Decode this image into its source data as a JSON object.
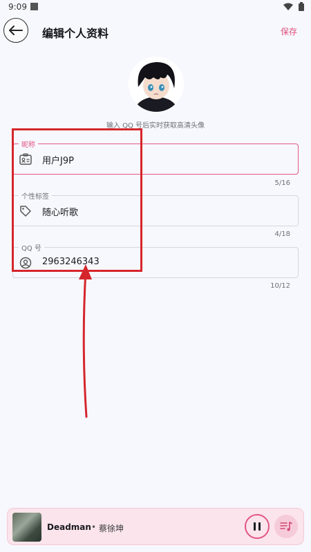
{
  "status_bar": {
    "time": "9:09"
  },
  "header": {
    "title": "编辑个人资料",
    "save_label": "保存"
  },
  "avatar": {
    "hint": "输入 QQ 号后实时获取高清头像"
  },
  "fields": [
    {
      "label": "昵称",
      "value": "用户J9P",
      "counter": "5/16",
      "icon": "id-card-icon",
      "focused": true
    },
    {
      "label": "个性标签",
      "value": "随心听歌",
      "counter": "4/18",
      "icon": "tag-icon",
      "focused": false
    },
    {
      "label": "QQ 号",
      "value": "2963246343",
      "counter": "10/12",
      "icon": "account-circle-icon",
      "focused": false
    }
  ],
  "player": {
    "song": "Deadman",
    "separator": "•",
    "artist": "蔡徐坤"
  },
  "colors": {
    "accent": "#e35584",
    "annotation": "#d5262c",
    "background": "#f7f8fd"
  }
}
